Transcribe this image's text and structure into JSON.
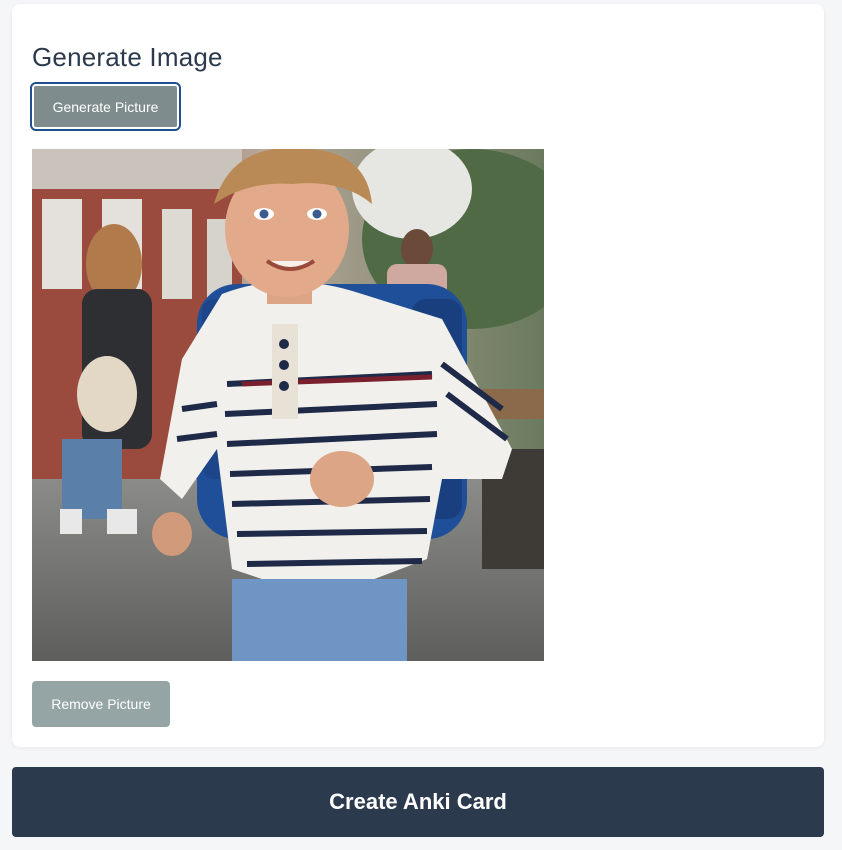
{
  "image_section": {
    "title": "Generate Image",
    "generate_button_label": "Generate Picture",
    "remove_button_label": "Remove Picture",
    "picture_description": "boy with blue backpack running"
  },
  "actions": {
    "create_card_label": "Create Anki Card"
  },
  "colors": {
    "background": "#f5f6f8",
    "card": "#ffffff",
    "title_text": "#2c3a4d",
    "generate_button": "#7f8c8d",
    "focus_ring": "#1f4f8f",
    "remove_button": "#95a5a6",
    "create_button": "#2c3a4e"
  }
}
